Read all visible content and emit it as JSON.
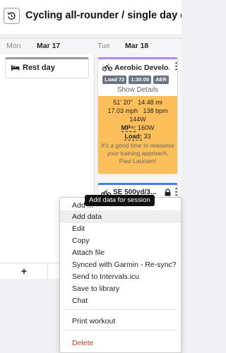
{
  "header": {
    "title": "Cycling all-rounder / single day event",
    "history_icon": "history-icon"
  },
  "days": [
    {
      "dow": "Mon",
      "date": "Mar 17"
    },
    {
      "dow": "Tue",
      "date": "Mar 18"
    }
  ],
  "mon": {
    "rest_label": "Rest day",
    "rest_icon": "bed-icon"
  },
  "aerobic": {
    "name": "Aerobic Develo...",
    "icon": "bike-icon",
    "badges": [
      "Load 72",
      "1:30:00",
      "AER"
    ],
    "show_details": "Show Details",
    "time": "51' 20\"",
    "distance": "14.48 mi",
    "speed": "17.03 mph",
    "hr": "138 bpm",
    "power": "144W",
    "mp_label": "MP⁴:",
    "mp_value": " 160W",
    "load_label": "Load:",
    "load_value": " 33",
    "note": "It's a good time to reassess your training approach, Paul Laursen!",
    "accent_color": "#fdbf5a"
  },
  "se": {
    "name": "SE 500yd/3...",
    "icon": "bike-icon",
    "lock_icon": "lock-icon"
  },
  "add_label": "+",
  "tooltip": "Add data for session",
  "menu": {
    "items": [
      "Add ...",
      "Add data",
      "Edit",
      "Copy",
      "Attach file",
      "Synced with Garmin - Re-sync?",
      "Send to Intervals.icu",
      "Save to library",
      "Chat",
      "Print workout",
      "Delete"
    ]
  }
}
